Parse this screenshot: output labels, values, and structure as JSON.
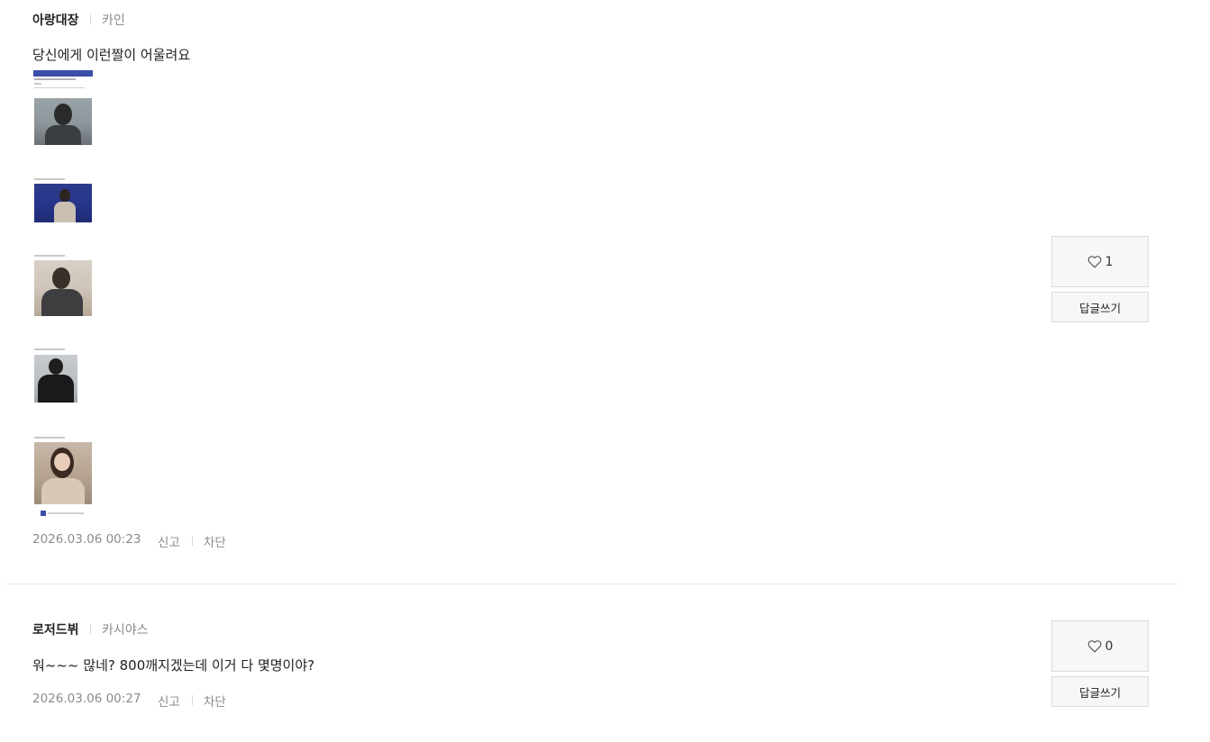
{
  "comments": [
    {
      "nickname": "아랑대장",
      "team": "카인",
      "content": "당신에게 이런짤이 어울려요",
      "date": "2026.03.06 00:23",
      "report_label": "신고",
      "block_label": "차단",
      "likes": "1",
      "reply_label": "답글쓰기"
    },
    {
      "nickname": "로저드뷔",
      "team": "카시야스",
      "content": "워~~~ 많네? 800깨지겠는데 이거 다 몇명이야?",
      "date": "2026.03.06 00:27",
      "report_label": "신고",
      "block_label": "차단",
      "likes": "0",
      "reply_label": "답글쓰기"
    }
  ],
  "colors": {
    "nickname": "#222222",
    "muted": "#8a8a8a",
    "button_bg": "#f7f7f7",
    "button_border": "#dcdcdc",
    "thumb_banner": "#3b4fa8"
  },
  "icons": {
    "like": "heart-outline-icon"
  }
}
